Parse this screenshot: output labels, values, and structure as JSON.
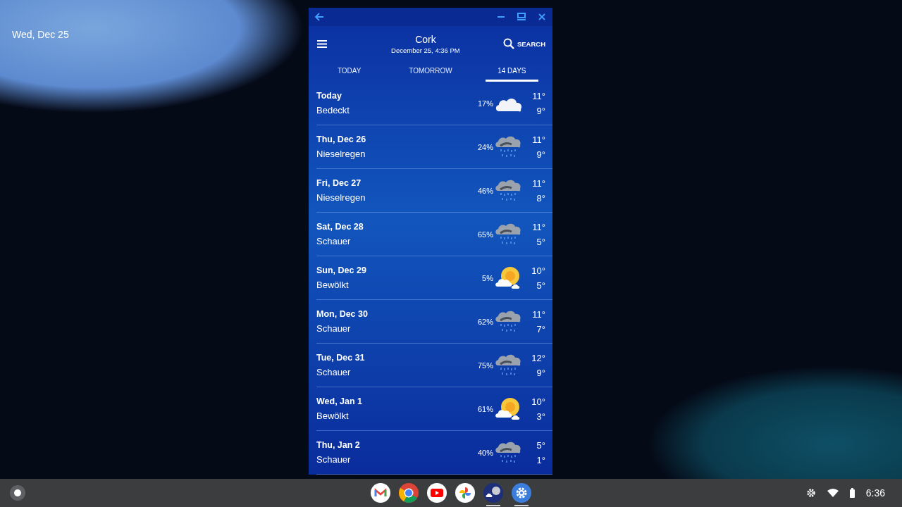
{
  "desktop": {
    "date": "Wed, Dec 25"
  },
  "window": {
    "header": {
      "city": "Cork",
      "datetime": "December 25, 4:36 PM",
      "search": "SEARCH"
    },
    "tabs": [
      {
        "label": "TODAY",
        "selected": false
      },
      {
        "label": "TOMORROW",
        "selected": false
      },
      {
        "label": "14 DAYS",
        "selected": true
      }
    ],
    "days": [
      {
        "day": "Today",
        "condition": "Bedeckt",
        "precip": "17%",
        "kind": "overcast",
        "high": "11°",
        "low": "9°"
      },
      {
        "day": "Thu, Dec 26",
        "condition": "Nieselregen",
        "precip": "24%",
        "kind": "rain",
        "high": "11°",
        "low": "9°"
      },
      {
        "day": "Fri, Dec 27",
        "condition": "Nieselregen",
        "precip": "46%",
        "kind": "rain",
        "high": "11°",
        "low": "8°"
      },
      {
        "day": "Sat, Dec 28",
        "condition": "Schauer",
        "precip": "65%",
        "kind": "rain",
        "high": "11°",
        "low": "5°"
      },
      {
        "day": "Sun, Dec 29",
        "condition": "Bewölkt",
        "precip": "5%",
        "kind": "sun-cloud",
        "high": "10°",
        "low": "5°"
      },
      {
        "day": "Mon, Dec 30",
        "condition": "Schauer",
        "precip": "62%",
        "kind": "rain",
        "high": "11°",
        "low": "7°"
      },
      {
        "day": "Tue, Dec 31",
        "condition": "Schauer",
        "precip": "75%",
        "kind": "rain",
        "high": "12°",
        "low": "9°"
      },
      {
        "day": "Wed, Jan 1",
        "condition": "Bewölkt",
        "precip": "61%",
        "kind": "sun-cloud",
        "high": "10°",
        "low": "3°"
      },
      {
        "day": "Thu, Jan 2",
        "condition": "Schauer",
        "precip": "40%",
        "kind": "rain",
        "high": "5°",
        "low": "1°"
      }
    ]
  },
  "taskbar": {
    "apps": [
      {
        "kind": "mail",
        "running": false
      },
      {
        "kind": "browser",
        "running": false
      },
      {
        "kind": "video",
        "running": false
      },
      {
        "kind": "photos",
        "running": false
      },
      {
        "kind": "weather",
        "running": true
      },
      {
        "kind": "settings",
        "running": true
      }
    ],
    "time": "6:36"
  }
}
